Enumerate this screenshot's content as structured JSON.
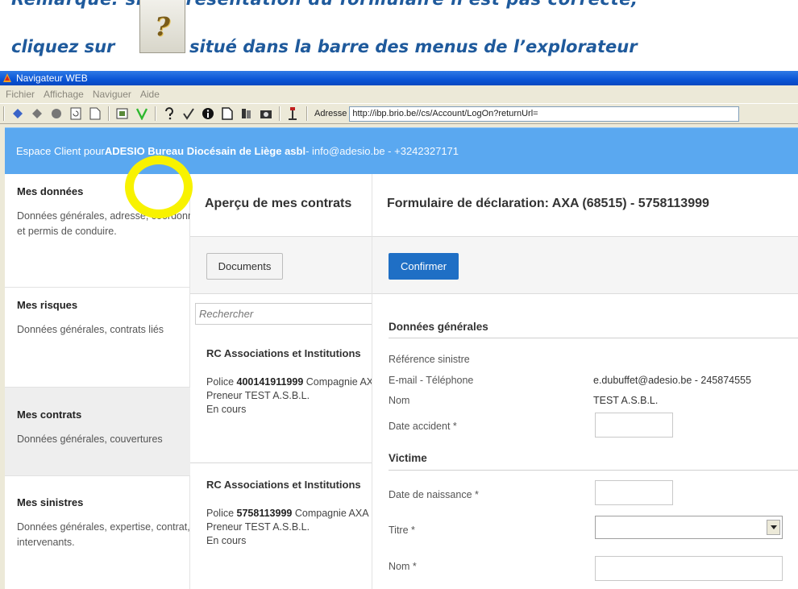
{
  "caption": {
    "line1": "Remarque: si la présentation du formulaire n'est pas correcte,",
    "line2_before": "cliquez sur",
    "help_icon": "?",
    "line2_after": "situé dans la barre des menus de l’explorateur"
  },
  "window": {
    "title": "Navigateur WEB",
    "menu": [
      "Fichier",
      "Affichage",
      "Naviguer",
      "Aide"
    ],
    "address_label": "Adresse",
    "address_value": "http://ibp.brio.be//cs/Account/LogOn?returnUrl=",
    "toolbar_icons": [
      "back-arrow-icon",
      "forward-arrow-icon",
      "stop-icon",
      "refresh-icon",
      "page-icon",
      "compat-view-icon",
      "green-check-icon",
      "help-icon",
      "spellcheck-icon",
      "info-icon",
      "document-icon",
      "bookmark-icon",
      "camera-icon",
      "tool-icon"
    ],
    "highlight_color": "#f8f200"
  },
  "site": {
    "header_prefix": "Espace Client pour ",
    "header_org": "ADESIO Bureau Diocésain de Liège asbl",
    "header_contact": " - info@adesio.be - +3242327171",
    "header_color": "#5aa8f0"
  },
  "sidebar": {
    "items": [
      {
        "title": "Mes données",
        "desc1": "Données générales, adresse, coordonnées",
        "desc2": "et permis de conduire."
      },
      {
        "title": "Mes risques",
        "desc1": "Données générales, contrats liés",
        "desc2": ""
      },
      {
        "title": "Mes contrats",
        "desc1": "Données générales, couvertures",
        "desc2": ""
      },
      {
        "title": "Mes sinistres",
        "desc1": "Données générales, expertise, contrat,",
        "desc2": "intervenants."
      }
    ]
  },
  "contracts": {
    "heading": "Aperçu de mes contrats",
    "documents_button": "Documents",
    "search_placeholder": "Rechercher",
    "items": [
      {
        "title": "RC Associations et Institutions",
        "police_label": "Police ",
        "police_no": "400141911999",
        "company": " Compagnie AXA",
        "preneur": "Preneur TEST A.S.B.L.",
        "status": "En cours"
      },
      {
        "title": "RC Associations et Institutions",
        "police_label": "Police ",
        "police_no": "5758113999",
        "company": " Compagnie AXA",
        "preneur": "Preneur TEST A.S.B.L.",
        "status": "En cours"
      }
    ]
  },
  "form": {
    "heading": "Formulaire de déclaration: AXA (68515) - 5758113999",
    "confirm_button": "Confirmer",
    "general_section": "Données générales",
    "ref_label": "Référence sinistre",
    "email_label": "E-mail - Téléphone",
    "email_value": "e.dubuffet@adesio.be - 245874555",
    "name_label": "Nom",
    "name_value": "TEST A.S.B.L.",
    "accident_label": "Date accident *",
    "victim_section": "Victime",
    "birth_label": "Date de naissance *",
    "title_label": "Titre *",
    "lastname_label": "Nom *"
  }
}
